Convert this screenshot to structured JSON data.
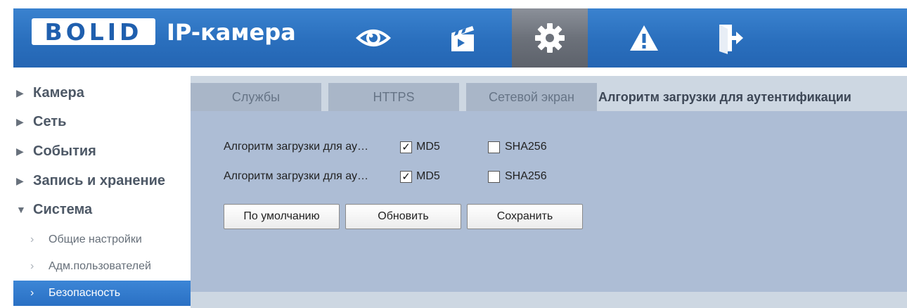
{
  "header": {
    "logo_text": "BOLID",
    "title": "IP-камера",
    "nav_icons": [
      "eye-icon",
      "clapperboard-icon",
      "gear-icon",
      "warning-icon",
      "logout-icon"
    ],
    "active_icon": "gear-icon"
  },
  "sidebar": {
    "items": [
      {
        "label": "Камера",
        "expanded": false
      },
      {
        "label": "Сеть",
        "expanded": false
      },
      {
        "label": "События",
        "expanded": false
      },
      {
        "label": "Запись и хранение",
        "expanded": false
      },
      {
        "label": "Система",
        "expanded": true
      }
    ],
    "subitems": [
      {
        "label": "Общие настройки",
        "active": false
      },
      {
        "label": "Адм.пользователей",
        "active": false
      },
      {
        "label": "Безопасность",
        "active": true
      }
    ]
  },
  "tabs": [
    {
      "label": "Службы",
      "active": false
    },
    {
      "label": "HTTPS",
      "active": false
    },
    {
      "label": "Сетевой экран",
      "active": false
    },
    {
      "label": "Алгоритм загрузки для аутентификации",
      "active": true
    }
  ],
  "settings": {
    "rows": [
      {
        "label": "Алгоритм загрузки для ау…",
        "md5_label": "MD5",
        "md5_checked": true,
        "sha_label": "SHA256",
        "sha_checked": false
      },
      {
        "label": "Алгоритм загрузки для ау…",
        "md5_label": "MD5",
        "md5_checked": true,
        "sha_label": "SHA256",
        "sha_checked": false
      }
    ]
  },
  "buttons": {
    "default": "По умолчанию",
    "refresh": "Обновить",
    "save": "Сохранить"
  },
  "colors": {
    "header_blue": "#2a6fbd",
    "active_menu_blue": "#2a70c4",
    "panel_bg": "#adbdd5",
    "content_bg": "#cdd7e2"
  }
}
